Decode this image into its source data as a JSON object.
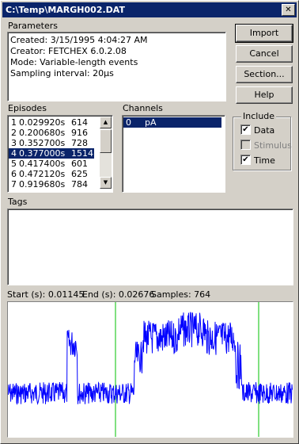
{
  "window": {
    "title": "C:\\Temp\\MARGH002.DAT",
    "close_label": "✕"
  },
  "parameters": {
    "label": "Parameters",
    "lines": [
      "Created: 3/15/1995 4:04:27 AM",
      "Creator: FETCHEX 6.0.2.08",
      "Mode: Variable-length events",
      "Sampling interval: 20µs"
    ]
  },
  "buttons": {
    "import": "Import",
    "cancel": "Cancel",
    "section": "Section...",
    "help": "Help"
  },
  "episodes": {
    "label": "Episodes",
    "rows": [
      {
        "n": "1",
        "t": "0.029920s",
        "v": "614"
      },
      {
        "n": "2",
        "t": "0.200680s",
        "v": "916"
      },
      {
        "n": "3",
        "t": "0.352700s",
        "v": "728"
      },
      {
        "n": "4",
        "t": "0.377000s",
        "v": "1514"
      },
      {
        "n": "5",
        "t": "0.417400s",
        "v": "601"
      },
      {
        "n": "6",
        "t": "0.472120s",
        "v": "625"
      },
      {
        "n": "7",
        "t": "0.919680s",
        "v": "784"
      }
    ],
    "selected_index": 3
  },
  "channels": {
    "label": "Channels",
    "rows": [
      {
        "n": "0",
        "unit": "pA"
      }
    ]
  },
  "include": {
    "label": "Include",
    "data": "Data",
    "stimulus": "Stimulus",
    "time": "Time",
    "data_checked": true,
    "stimulus_checked": true,
    "time_checked": true
  },
  "tags": {
    "label": "Tags"
  },
  "status": {
    "start": "Start (s): 0.01145",
    "end": "End (s): 0.02676",
    "samples": "Samples: 764"
  },
  "colors": {
    "trace": "#0000ff",
    "marker": "#00c000",
    "selection": "#0a246a"
  }
}
